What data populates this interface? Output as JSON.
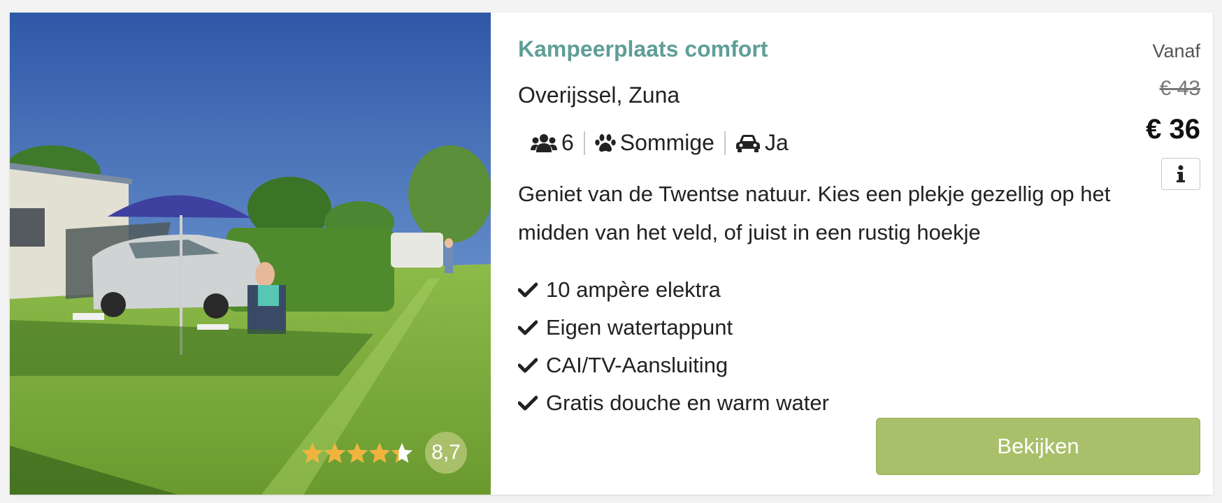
{
  "photo": {
    "alt": "Camping pitch with caravan, car and parasol"
  },
  "rating": {
    "stars": 4.35,
    "max_stars": 5,
    "score": "8,7",
    "star_color": "#f2b33d",
    "score_color": "#a9c06b"
  },
  "listing": {
    "title": "Kampeerplaats comfort",
    "location": "Overijssel, Zuna",
    "features": {
      "persons": "6",
      "pets": "Sommige",
      "car": "Ja"
    },
    "description": "Geniet van de Twentse natuur. Kies een plekje gezellig op het midden van het veld, of juist in een rustig hoekje",
    "amenities": [
      "10 ampère elektra",
      "Eigen watertappunt",
      "CAI/TV-Aansluiting",
      "Gratis douche en warm water"
    ]
  },
  "price": {
    "from_label": "Vanaf",
    "old": "€ 43",
    "new": "€ 36"
  },
  "actions": {
    "info_icon": "info-icon",
    "book_label": "Bekijken"
  },
  "colors": {
    "title": "#5f9e98",
    "button": "#a9c06b"
  }
}
